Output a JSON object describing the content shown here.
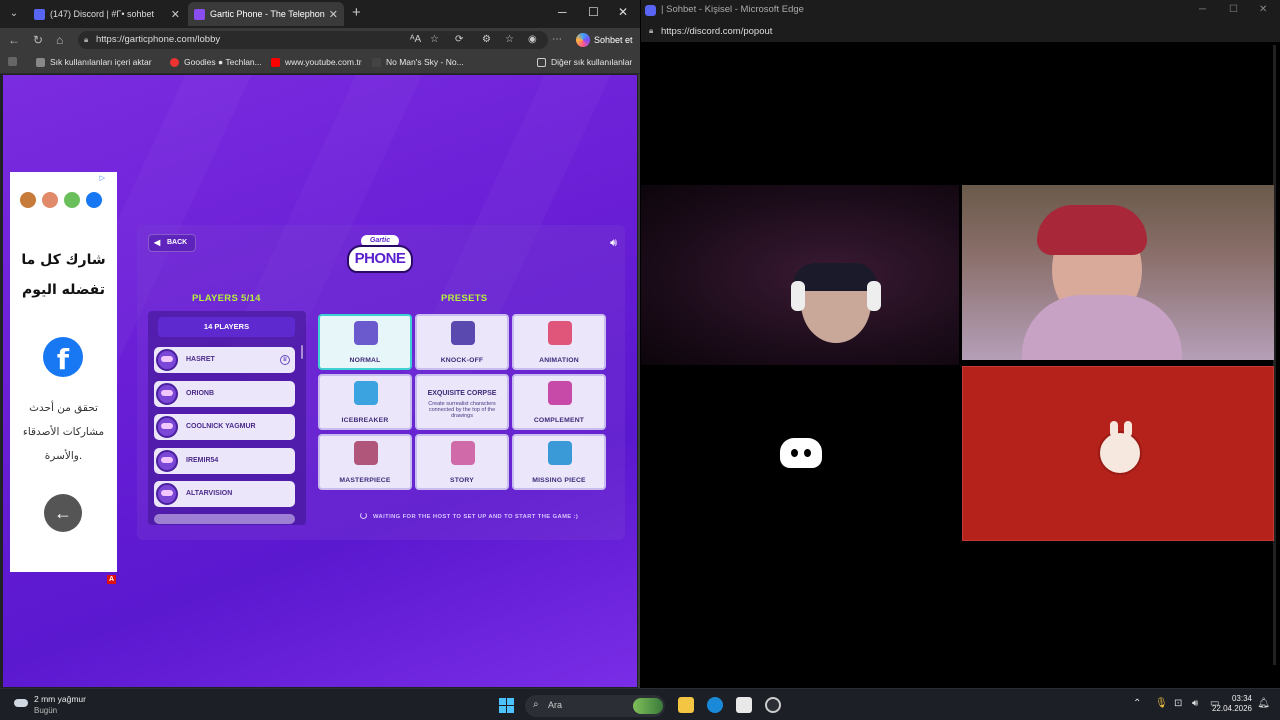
{
  "browser": {
    "tabs": [
      {
        "title": "(147) Discord | #Γ• sohbet",
        "favicon_color": "#5865f2"
      },
      {
        "title": "Gartic Phone - The Telephone Gar",
        "favicon_color": "#8a4df0"
      }
    ],
    "url": "https://garticphone.com/lobby",
    "sohbet_label": "Sohbet et",
    "bookmarks": [
      {
        "label": "Sık kullanılanları içeri aktar",
        "icon": "import-icon"
      },
      {
        "label": "Goodies ● Techlan...",
        "icon": "goodies-icon"
      },
      {
        "label": "www.youtube.com.tr",
        "icon": "youtube-icon"
      },
      {
        "label": "No Man's Sky - No...",
        "icon": "nms-icon"
      },
      {
        "label": "Diğer sık kullanılanlar",
        "icon": "folder-icon"
      }
    ]
  },
  "ad": {
    "headline_line1": "شارك كل ما",
    "headline_line2": "تفضله اليوم",
    "body_line1": "تحقق من أحدث",
    "body_line2": "مشاركات الأصدقاء",
    "body_line3": "والأسرة.",
    "fb_glyph": "f",
    "badge": "A"
  },
  "game": {
    "back_label": "BACK",
    "logo_top": "Gartic",
    "logo_main": "PHONE",
    "players_title": "PLAYERS 5/14",
    "presets_title": "PRESETS",
    "player_count": "14 PLAYERS",
    "players": [
      "HASRET",
      "ORIONB",
      "COOLNICK YAGMUR",
      "IREMIR54",
      "ALTARVISION"
    ],
    "presets": [
      {
        "label": "NORMAL",
        "color": "#6a5acd",
        "selected": true
      },
      {
        "label": "KNOCK-OFF",
        "color": "#5a4ab0"
      },
      {
        "label": "ANIMATION",
        "color": "#e0567a"
      },
      {
        "label": "ICEBREAKER",
        "color": "#3aa3e0"
      },
      {
        "label": "EXQUISITE CORPSE",
        "desc": "Create surrealist characters connected by the top of the drawings"
      },
      {
        "label": "COMPLEMENT",
        "color": "#c84aa8"
      },
      {
        "label": "MASTERPIECE",
        "color": "#b0567a"
      },
      {
        "label": "STORY",
        "color": "#d06aa8"
      },
      {
        "label": "MISSING PIECE",
        "color": "#3a9ad8"
      }
    ],
    "waiting": "WAITING FOR THE HOST TO SET UP AND TO START THE GAME :)"
  },
  "discord": {
    "title": "| Sohbet - Kişisel - Microsoft Edge",
    "url": "https://discord.com/popout"
  },
  "taskbar": {
    "weather_temp": "2 mm yağmur",
    "weather_sub": "Bugün",
    "search_placeholder": "Ara",
    "time": "03:34",
    "date": "22.04.2026"
  }
}
